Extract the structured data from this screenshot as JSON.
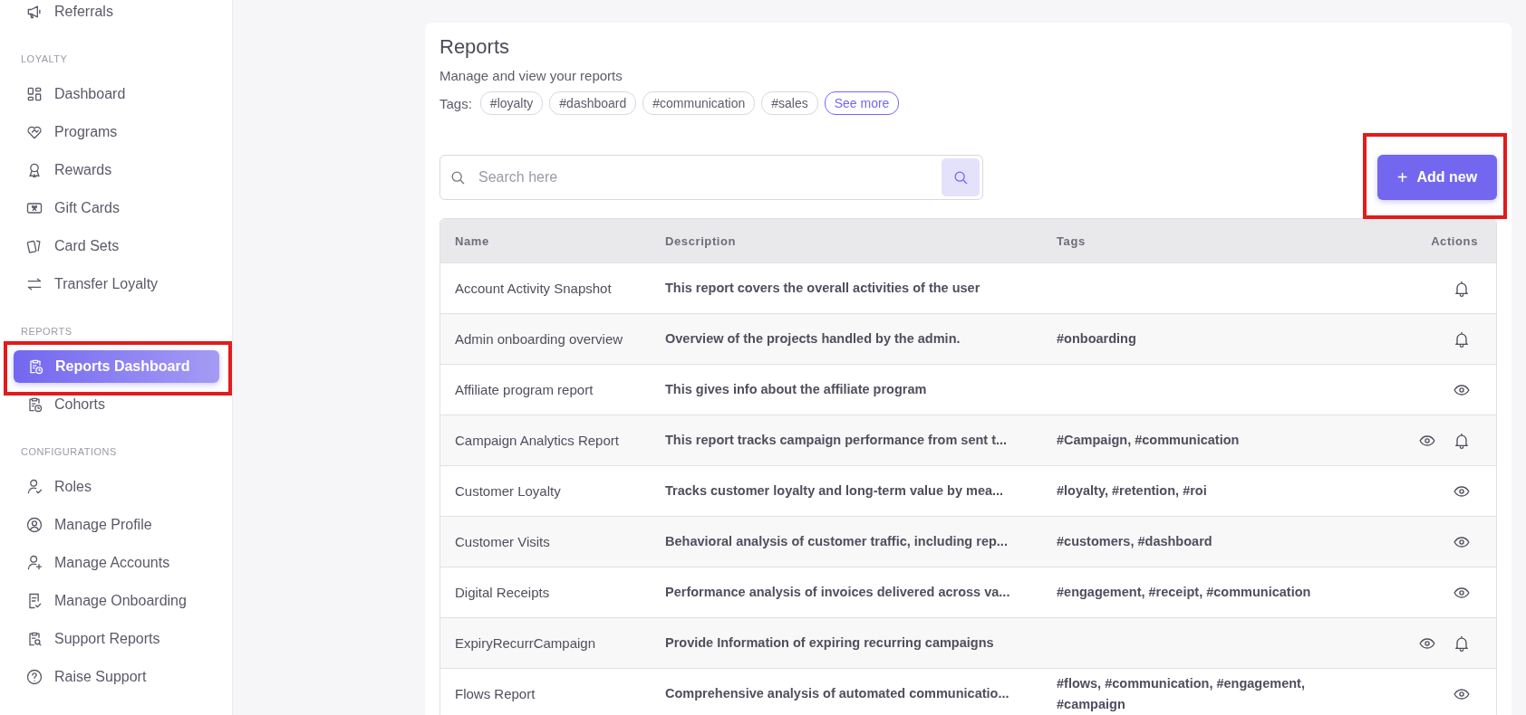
{
  "sidebar": {
    "items": [
      {
        "kind": "item",
        "label": "Referrals",
        "selected": false,
        "highlighted": false
      },
      {
        "kind": "heading",
        "label": "LOYALTY"
      },
      {
        "kind": "item",
        "label": "Dashboard",
        "selected": false,
        "highlighted": false
      },
      {
        "kind": "item",
        "label": "Programs",
        "selected": false,
        "highlighted": false
      },
      {
        "kind": "item",
        "label": "Rewards",
        "selected": false,
        "highlighted": false
      },
      {
        "kind": "item",
        "label": "Gift Cards",
        "selected": false,
        "highlighted": false
      },
      {
        "kind": "item",
        "label": "Card Sets",
        "selected": false,
        "highlighted": false
      },
      {
        "kind": "item",
        "label": "Transfer Loyalty",
        "selected": false,
        "highlighted": false
      },
      {
        "kind": "heading",
        "label": "REPORTS"
      },
      {
        "kind": "item",
        "label": "Reports Dashboard",
        "selected": true,
        "highlighted": true
      },
      {
        "kind": "item",
        "label": "Cohorts",
        "selected": false,
        "highlighted": false
      },
      {
        "kind": "heading",
        "label": "CONFIGURATIONS"
      },
      {
        "kind": "item",
        "label": "Roles",
        "selected": false,
        "highlighted": false
      },
      {
        "kind": "item",
        "label": "Manage Profile",
        "selected": false,
        "highlighted": false
      },
      {
        "kind": "item",
        "label": "Manage Accounts",
        "selected": false,
        "highlighted": false
      },
      {
        "kind": "item",
        "label": "Manage Onboarding",
        "selected": false,
        "highlighted": false
      },
      {
        "kind": "item",
        "label": "Support Reports",
        "selected": false,
        "highlighted": false
      },
      {
        "kind": "item",
        "label": "Raise Support",
        "selected": false,
        "highlighted": false
      }
    ]
  },
  "page": {
    "title": "Reports",
    "subtitle": "Manage and view your reports",
    "tags_label": "Tags:",
    "tags": [
      "#loyalty",
      "#dashboard",
      "#communication",
      "#sales"
    ],
    "see_more": "See more"
  },
  "search": {
    "placeholder": "Search here"
  },
  "add_button": {
    "label": "Add new",
    "icon": "+",
    "highlighted": true
  },
  "table": {
    "columns": [
      "Name",
      "Description",
      "Tags",
      "Actions"
    ],
    "rows": [
      {
        "name": "Account Activity Snapshot",
        "description": "This report covers the overall activities of the user",
        "tags": "",
        "actions": [
          {
            "kind": "notify"
          }
        ]
      },
      {
        "name": "Admin onboarding overview",
        "description": "Overview of the projects handled by the admin.",
        "tags": "#onboarding",
        "actions": [
          {
            "kind": "notify"
          }
        ]
      },
      {
        "name": "Affiliate program report",
        "description": "This gives info about the affiliate program",
        "tags": "",
        "actions": [
          {
            "kind": "view"
          }
        ]
      },
      {
        "name": "Campaign Analytics Report",
        "description": "This report tracks campaign performance from sent t...",
        "tags": "#Campaign, #communication",
        "actions": [
          {
            "kind": "view"
          },
          {
            "kind": "notify"
          }
        ]
      },
      {
        "name": "Customer Loyalty",
        "description": "Tracks customer loyalty and long-term value by mea...",
        "tags": "#loyalty, #retention, #roi",
        "actions": [
          {
            "kind": "view"
          }
        ]
      },
      {
        "name": "Customer Visits",
        "description": "Behavioral analysis of customer traffic, including rep...",
        "tags": "#customers, #dashboard",
        "actions": [
          {
            "kind": "view"
          }
        ]
      },
      {
        "name": "Digital Receipts",
        "description": "Performance analysis of invoices delivered across va...",
        "tags": "#engagement, #receipt, #communication",
        "actions": [
          {
            "kind": "view"
          }
        ]
      },
      {
        "name": "ExpiryRecurrCampaign",
        "description": "Provide Information of expiring recurring campaigns",
        "tags": "",
        "actions": [
          {
            "kind": "view"
          },
          {
            "kind": "notify"
          }
        ]
      },
      {
        "name": "Flows Report",
        "description": "Comprehensive analysis of automated communicatio...",
        "tags": "#flows, #communication, #engagement, #campaign",
        "actions": [
          {
            "kind": "view"
          }
        ]
      }
    ]
  }
}
